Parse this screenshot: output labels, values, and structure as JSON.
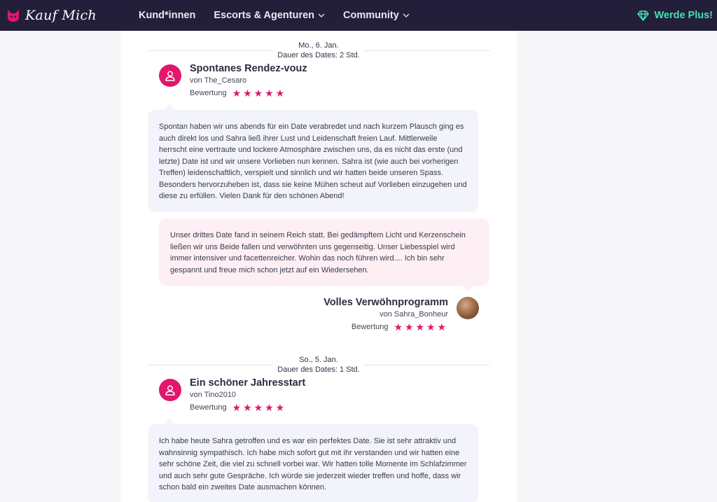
{
  "nav": {
    "logo_text": "Kauf Mich",
    "items": [
      {
        "label": "Kund*innen",
        "has_dropdown": false
      },
      {
        "label": "Escorts & Agenturen",
        "has_dropdown": true
      },
      {
        "label": "Community",
        "has_dropdown": true
      }
    ],
    "cta_label": "Werde Plus!",
    "colors": {
      "bar": "#231f3b",
      "cta": "#3ee6b0",
      "accent": "#e1166c"
    }
  },
  "dates": [
    {
      "date": "Mo., 6. Jan.",
      "duration": "Dauer des Dates: 2 Std."
    },
    {
      "date": "So., 5. Jan.",
      "duration": "Dauer des Dates: 1 Std."
    }
  ],
  "reviews": [
    {
      "title": "Spontanes Rendez-vouz",
      "author": "von The_Cesaro",
      "rating_label": "Bewertung",
      "stars": 5,
      "text": "Spontan haben wir uns abends für ein Date verabredet und nach kurzem Plausch ging es auch direkt los und Sahra ließ ihrer Lust und Leidenschaft freien Lauf. Mittlerweile herrscht eine vertraute und lockere Atmosphäre zwischen uns, da es nicht das erste (und letzte) Date ist und wir unsere Vorlieben nun kennen. Sahra ist (wie auch bei vorherigen Treffen) leidenschaftlich, verspielt und sinnlich und wir hatten beide unseren Spass. Besonders hervorzuheben ist, dass sie keine Mühen scheut auf Vorlieben einzugehen und diese zu erfüllen. Vielen Dank für den schönen Abend!"
    },
    {
      "title": "Volles Verwöhnprogramm",
      "author": "von Sahra_Bonheur",
      "rating_label": "Bewertung",
      "stars": 5,
      "text": "Unser drittes Date fand in seinem Reich statt. Bei gedämpftem Licht und Kerzenschein ließen wir uns Beide fallen und verwöhnten uns gegenseitig. Unser Liebesspiel wird immer intensiver und facettenreicher. Wohin das noch führen wird.... Ich bin sehr gespannt und freue mich schon jetzt auf ein Wiedersehen."
    },
    {
      "title": "Ein schöner Jahresstart",
      "author": "von Tino2010",
      "rating_label": "Bewertung",
      "stars": 5,
      "text": "Ich habe heute Sahra getroffen und es war ein perfektes Date. Sie ist sehr attraktiv und wahnsinnig sympathisch. Ich habe mich sofort gut mit ihr verstanden und wir hatten eine sehr schöne Zeit, die viel zu schnell vorbei war. Wir hatten tolle Momente im Schlafzimmer und auch sehr gute Gespräche. Ich würde sie jederzeit wieder treffen und hoffe, dass wir schon bald ein zweites Date ausmachen können."
    }
  ]
}
